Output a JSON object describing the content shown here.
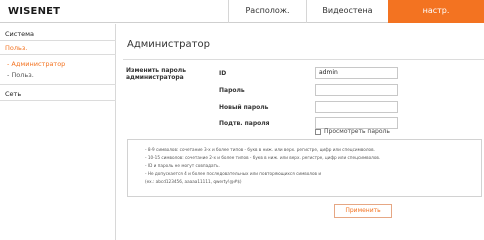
{
  "header": {
    "logo": "WISENET",
    "nav": [
      {
        "label": "Располож."
      },
      {
        "label": "Видеостена"
      },
      {
        "label": "настр."
      }
    ]
  },
  "sidebar": {
    "system": "Система",
    "users_group": "Польз.",
    "users_items": [
      "- Администратор",
      "- Польз."
    ],
    "network": "Сеть"
  },
  "main": {
    "title": "Администратор",
    "section_label": "Изменить пароль администратора",
    "fields": [
      {
        "label": "ID",
        "value": "admin"
      },
      {
        "label": "Пароль",
        "value": ""
      },
      {
        "label": "Новый пароль",
        "value": ""
      },
      {
        "label": "Подтв. пароля",
        "value": ""
      }
    ],
    "show_password_label": "Просмотреть пароль",
    "notes": [
      "- 8-9 символов: сочетание 3-х и более типов - букв в ниж. или верх. регистре, цифр или спецсимволов.",
      "- 10-15 символов: сочетание 2-х и более типов - букв в ниж. или верх. регистре, цифр или спецсимволов.",
      "- ID и пароль не могут совпадать.",
      "- Не допускается 4 и более последовательных или повторяющихся символов и",
      "(ex.: abcd123456, aaaaa11111, qwerty!@#$)"
    ],
    "apply_label": "Применить"
  },
  "colors": {
    "accent": "#f37321"
  }
}
